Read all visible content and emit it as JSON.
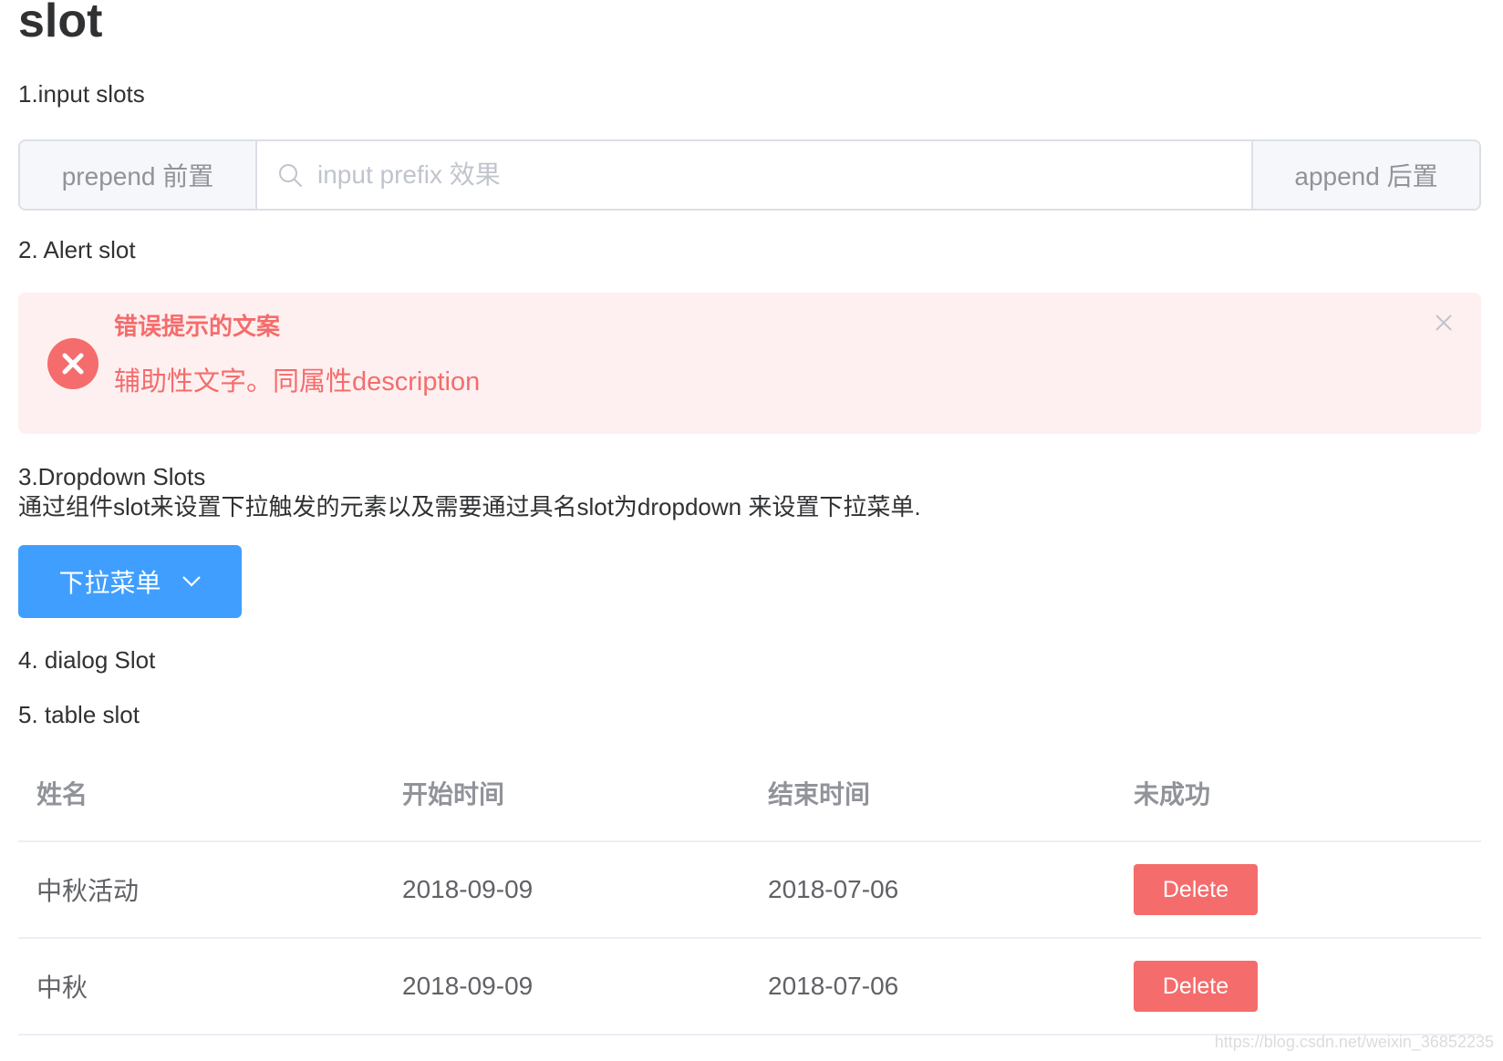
{
  "page": {
    "title": "slot"
  },
  "sections": {
    "input": "1.input slots",
    "alert": "2. Alert slot",
    "dropdown": "3.Dropdown Slots",
    "dropdown_desc": "通过组件slot来设置下拉触发的元素以及需要通过具名slot为dropdown 来设置下拉菜单.",
    "dialog": "4. dialog Slot",
    "table": "5. table slot"
  },
  "input_group": {
    "prepend": "prepend 前置",
    "placeholder": "input prefix 效果",
    "value": "",
    "append": "append 后置",
    "prefix_icon": "search-icon"
  },
  "alert": {
    "title": "错误提示的文案",
    "description": "辅助性文字。同属性description",
    "type": "error",
    "icon": "error-circle-icon",
    "color": "#f56c6c",
    "background": "#fef0f0"
  },
  "dropdown": {
    "label": "下拉菜单",
    "icon": "chevron-down-icon",
    "color": "#409eff"
  },
  "table": {
    "columns": [
      "姓名",
      "开始时间",
      "结束时间",
      "未成功"
    ],
    "rows": [
      {
        "name": "中秋活动",
        "start": "2018-09-09",
        "end": "2018-07-06",
        "action": "Delete"
      },
      {
        "name": "中秋",
        "start": "2018-09-09",
        "end": "2018-07-06",
        "action": "Delete"
      }
    ]
  },
  "watermark": "https://blog.csdn.net/weixin_36852235"
}
